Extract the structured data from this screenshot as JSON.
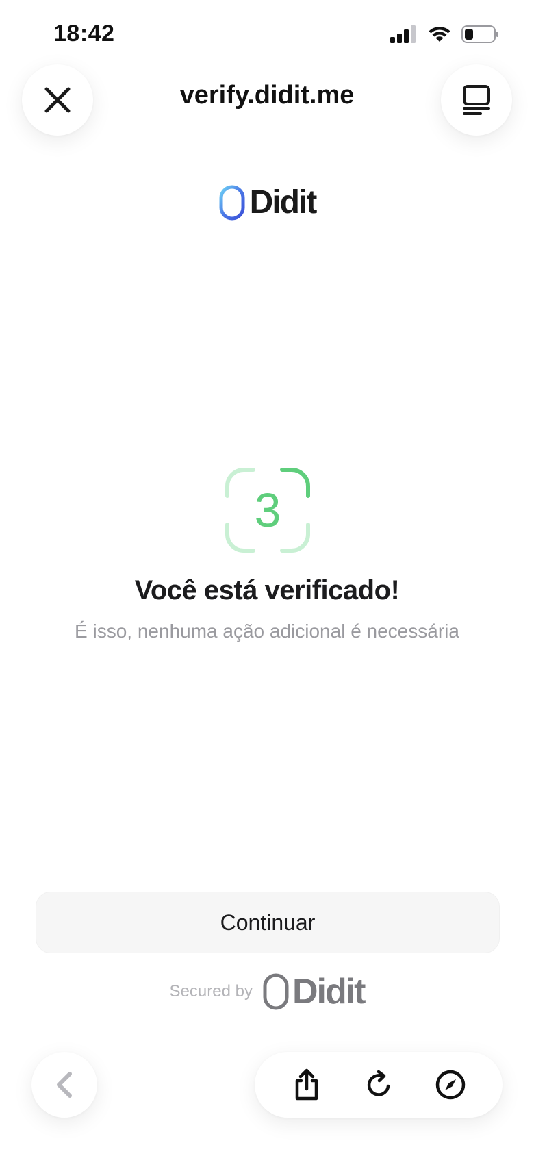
{
  "status_bar": {
    "time": "18:42"
  },
  "browser": {
    "title": "verify.didit.me"
  },
  "brand": {
    "name": "Didit"
  },
  "success": {
    "step_number": "3",
    "title": "Você está verificado!",
    "subtitle": "É isso, nenhuma ação adicional é necessária"
  },
  "actions": {
    "continue_label": "Continuar"
  },
  "footer": {
    "secured_label": "Secured by",
    "brand": "Didit"
  },
  "colors": {
    "success_green": "#5fce7c",
    "success_green_light": "#c9f0d4",
    "brand_blue": "#3a4fd8",
    "brand_cyan": "#6fd3f5"
  }
}
